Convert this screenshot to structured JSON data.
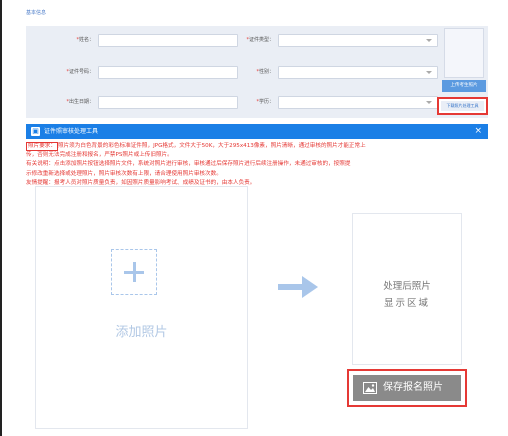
{
  "form": {
    "section_title": "基本信息",
    "labels": {
      "name": "姓名：",
      "id_type": "证件类型：",
      "id_number": "证件号码：",
      "gender": "性别：",
      "birth_date": "出生日期：",
      "education": "学历："
    },
    "required_mark": "*",
    "upload_photo_label": "上传考生照片",
    "photo_tool_label": "下载照片处理工具"
  },
  "dialog": {
    "title": "证件照审核处理工具",
    "close": "×",
    "notes": {
      "photo_req_label": "照片要求：",
      "photo_req_text": "照片须为白色背景的彩色标准证件照，JPG格式，文件大于50K，大于295x413像素，照片清晰，通过审核的照片才能正常上",
      "photo_req_text_2": "传，否则无法完成注册和报名，严禁PS照片或上传旧照片。",
      "usage": "有关说明：点击添加照片按钮选择照片文件，系统对照片进行审核，审核通过后保存照片进行后续注册操作，未通过审核的，按照提",
      "usage_2": "示修改重新选择或处理照片，照片审核次数有上限，请合理使用照片审核次数。",
      "tip": "友情提醒：报考人员对照片质量负责，如因照片质量影响考试、成绩及证书的，由本人负责。"
    },
    "add_photo_label": "添加照片",
    "result_line1": "处理后照片",
    "result_line2": "显示区域",
    "save_label": "保存报名照片"
  },
  "colors": {
    "primary_blue": "#1b7fe6",
    "highlight_red": "#e53935",
    "save_button_gray": "#8a8a8a"
  },
  "icons": [
    "dialog-app-icon",
    "close-icon",
    "plus-icon",
    "arrow-right-icon",
    "image-icon"
  ]
}
